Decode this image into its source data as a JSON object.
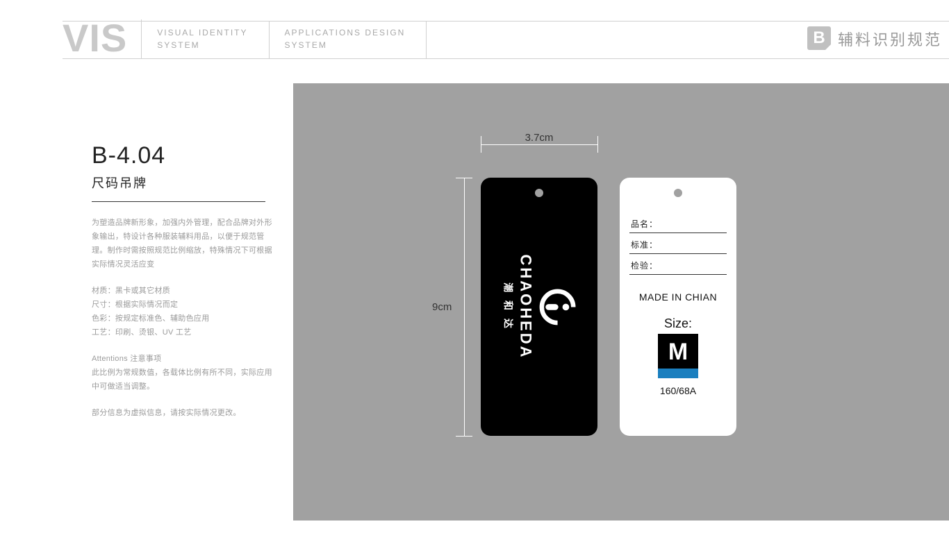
{
  "header": {
    "vis": "VIS",
    "sub1_line1": "VISUAL IDENTITY",
    "sub1_line2": "SYSTEM",
    "sub2_line1": "APPLICATIONS DESIGN",
    "sub2_line2": "SYSTEM",
    "badge_letter": "B",
    "section_title": "辅料识别规范"
  },
  "left": {
    "code": "B-4.04",
    "title": "尺码吊牌",
    "desc": "为塑造品牌新形象，加强内外管理，配合品牌对外形象输出，特设计各种服装辅料用品，以便于规范管理。制作时需按照规范比例缩放，特殊情况下可根据实际情况灵活应变",
    "spec_material": "材质：黑卡或其它材质",
    "spec_size": "尺寸：根据实际情况而定",
    "spec_color": "色彩：按规定标准色、辅助色应用",
    "spec_process": "工艺：印刷、烫银、UV 工艺",
    "attn_head": "Attentions 注意事项",
    "attn_body": "此比例为常规数值，各载体比例有所不同，实际应用中可做适当调整。",
    "note": "部分信息为虚拟信息，请按实际情况更改。"
  },
  "dims": {
    "width": "3.7cm",
    "height": "9cm"
  },
  "tag_black": {
    "brand_en": "CHAOHEDA",
    "brand_cn": "潮 和 达"
  },
  "tag_white": {
    "field1": "品名：",
    "field2": "标准：",
    "field3": "检验：",
    "made": "MADE IN CHIAN",
    "size_label": "Size:",
    "size_letter": "M",
    "size_code": "160/68A"
  }
}
